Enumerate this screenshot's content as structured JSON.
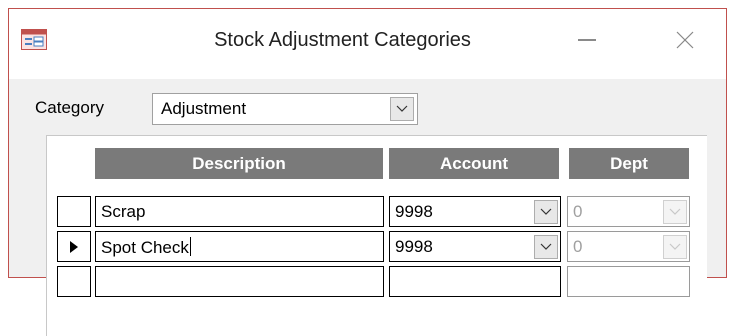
{
  "window": {
    "title": "Stock Adjustment Categories",
    "icon": "form-icon"
  },
  "category": {
    "label": "Category",
    "value": "Adjustment"
  },
  "grid": {
    "columns": [
      "Description",
      "Account",
      "Dept"
    ],
    "rows": [
      {
        "description": "Scrap",
        "account": "9998",
        "dept": "0",
        "current": false
      },
      {
        "description": "Spot Check",
        "account": "9998",
        "dept": "0",
        "current": true
      }
    ]
  },
  "colors": {
    "header_bg": "#7a7a7a",
    "window_border": "#c0504d"
  }
}
